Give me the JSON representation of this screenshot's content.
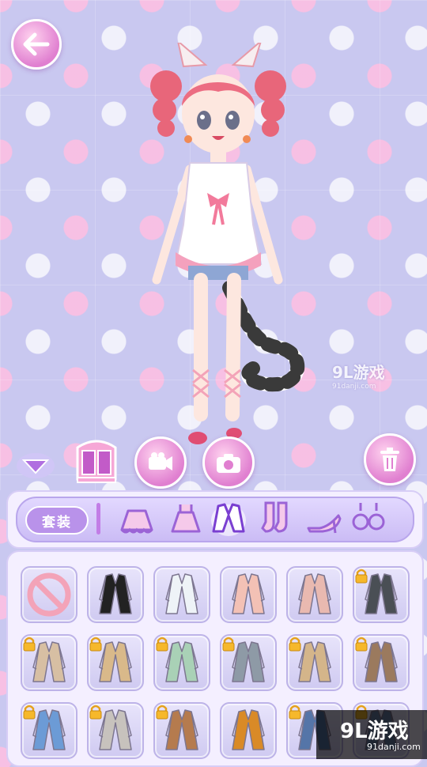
{
  "toolbar": {
    "back_icon": "back-arrow-icon",
    "toggle_icon": "collapse-triangle-icon",
    "wardrobe_icon": "wardrobe-icon",
    "video_icon": "video-camera-icon",
    "camera_icon": "camera-icon",
    "trash_icon": "trash-icon"
  },
  "categories": {
    "outfit_label": "套装",
    "items": [
      {
        "name": "skirt",
        "icon": "skirt-icon"
      },
      {
        "name": "dress",
        "icon": "dress-icon"
      },
      {
        "name": "jacket",
        "icon": "jacket-icon",
        "selected": true
      },
      {
        "name": "socks",
        "icon": "socks-icon"
      },
      {
        "name": "shoes",
        "icon": "high-heel-icon"
      },
      {
        "name": "earrings",
        "icon": "earrings-icon"
      }
    ]
  },
  "items": [
    {
      "icon": "none-icon",
      "locked": false,
      "color": "#f3a3b8"
    },
    {
      "icon": "black-jacket",
      "locked": false,
      "color": "#222222"
    },
    {
      "icon": "white-cardigan",
      "locked": false,
      "color": "#eef3f7"
    },
    {
      "icon": "pink-coat",
      "locked": false,
      "color": "#f3c1b5"
    },
    {
      "icon": "pink-blazer",
      "locked": false,
      "color": "#e9b9b0"
    },
    {
      "icon": "dark-trench",
      "locked": true,
      "color": "#4a4f55"
    },
    {
      "icon": "beige-trench",
      "locked": true,
      "color": "#d7bfa3"
    },
    {
      "icon": "khaki-jacket",
      "locked": true,
      "color": "#d9b98a"
    },
    {
      "icon": "green-cardigan",
      "locked": true,
      "color": "#a9d1b6"
    },
    {
      "icon": "plaid-blazer",
      "locked": true,
      "color": "#8e9aa6"
    },
    {
      "icon": "tan-blazer",
      "locked": true,
      "color": "#d4b58a"
    },
    {
      "icon": "brown-coat",
      "locked": true,
      "color": "#9b7a5e"
    },
    {
      "icon": "blue-cape",
      "locked": true,
      "color": "#6c9bd6"
    },
    {
      "icon": "grey-vest",
      "locked": true,
      "color": "#c7c2bd"
    },
    {
      "icon": "brown-long-coat",
      "locked": true,
      "color": "#b57b4e"
    },
    {
      "icon": "striped-sweater",
      "locked": false,
      "color": "#d98a27"
    },
    {
      "icon": "denim-jacket",
      "locked": true,
      "color": "#5575a8"
    },
    {
      "icon": "denim-coat",
      "locked": true,
      "color": "#6a7fa8"
    }
  ],
  "watermarks": {
    "middle_logo": "9L游戏",
    "middle_url": "91danji.com",
    "corner_logo": "9L游戏",
    "corner_url": "91danji.com"
  }
}
